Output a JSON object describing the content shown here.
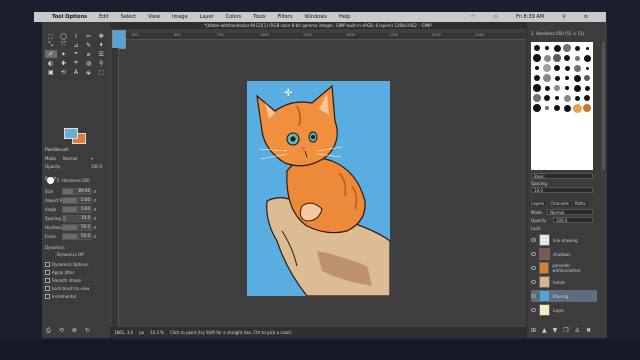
{
  "menubar": {
    "app_name": "Tool Options",
    "items": [
      "Edit",
      "Select",
      "View",
      "Image",
      "Layer",
      "Colors",
      "Tools",
      "Filters",
      "Windows",
      "Help"
    ],
    "clock": "Fri 8:39 AM"
  },
  "window": {
    "title": "*[kitten-withhandcolor-9412][1] (RGB color 8-bit gamma integer, GIMP built-in sRGB, 6 layers) 1280x1922 – GIMP"
  },
  "ruler": {
    "ticks": [
      "250",
      "500",
      "750",
      "1000",
      "1250",
      "1500",
      "1750",
      "2000",
      "2250"
    ]
  },
  "toolbox": {
    "tools": [
      "⬚",
      "◯",
      "⌇",
      "✂",
      "✥",
      "⤡",
      "⤧",
      "⊿",
      "✎",
      "⬧",
      "✐",
      "✦",
      "⌖",
      "⌀",
      "☰",
      "◐",
      "✚",
      "⌗",
      "◍",
      "⚲",
      "▣",
      "⟲",
      "A",
      "⬙",
      "⬚"
    ],
    "options_title": "Paintbrush",
    "mode_label": "Mode",
    "mode_value": "Normal",
    "opacity_label": "Opacity",
    "opacity_value": "100.0",
    "brush_label": "Brush",
    "brush_value": "2. Hardness 050",
    "sliders": [
      {
        "label": "Size",
        "value": "89.00",
        "frac": 0.35
      },
      {
        "label": "Aspect Ratio",
        "value": "0.00",
        "frac": 0.5
      },
      {
        "label": "Angle",
        "value": "0.00",
        "frac": 0.5
      },
      {
        "label": "Spacing",
        "value": "10.0",
        "frac": 0.1
      },
      {
        "label": "Hardness",
        "value": "50.0",
        "frac": 0.5
      },
      {
        "label": "Force",
        "value": "50.0",
        "frac": 0.5
      }
    ],
    "dynamics_label": "Dynamics",
    "dynamics_value": "Dynamics Off",
    "checks": [
      "Dynamics Options",
      "Apply Jitter",
      "Smooth stroke",
      "Lock brush to view",
      "Incremental"
    ]
  },
  "colors": {
    "fg": "#6aaed6",
    "bg": "#e07a3a"
  },
  "statusbar": {
    "coords": "1861, 3.0",
    "unit": "px",
    "zoom": "33.3 %",
    "message": "Click to paint (try Shift for a straight line, Ctrl to pick a color)"
  },
  "right": {
    "brushes_title": "2. Hardness 050 (51 × 51)",
    "filter_placeholder": "Basic",
    "spacing_label": "Spacing",
    "spacing_value": "10.0",
    "tabs": [
      "Layers",
      "Channels",
      "Paths"
    ],
    "mode_label": "Mode",
    "mode_value": "Normal",
    "opacity_label": "Opacity",
    "opacity_value": "100.0",
    "lock_label": "Lock:",
    "layers": [
      {
        "name": "line drawing",
        "color": "#e6e6e6"
      },
      {
        "name": "shadows",
        "color": "#7a5a4a"
      },
      {
        "name": "parseller-withfurclothes",
        "color": "#d57f3b"
      },
      {
        "name": "hands",
        "color": "#d8b58c"
      },
      {
        "name": "Blue-bg",
        "color": "#4aa6dd"
      },
      {
        "name": "Layer",
        "color": "#f0f0c0"
      }
    ]
  }
}
